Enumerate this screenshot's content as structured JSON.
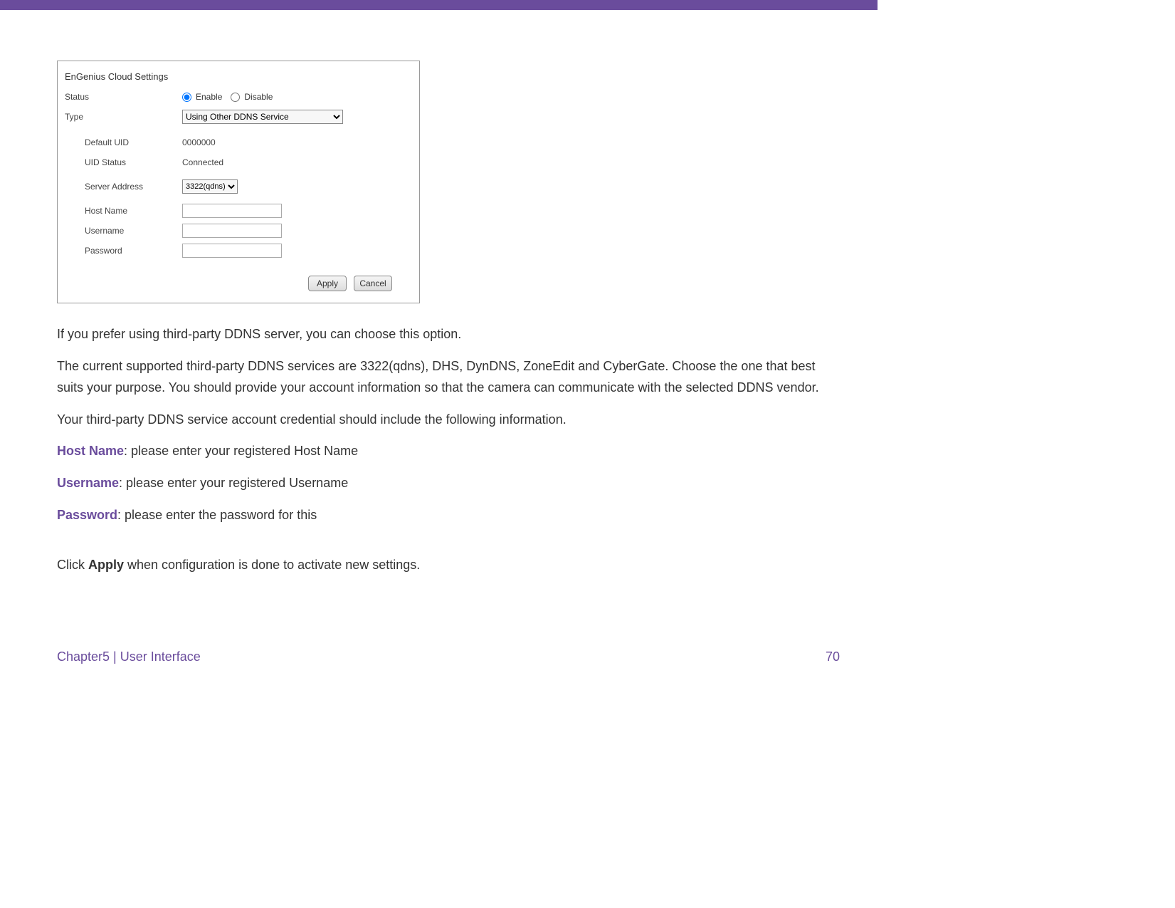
{
  "panel": {
    "title": "EnGenius Cloud Settings",
    "status_label": "Status",
    "enable_label": "Enable",
    "disable_label": "Disable",
    "type_label": "Type",
    "type_value": "Using Other DDNS Service",
    "default_uid_label": "Default UID",
    "default_uid_value": "0000000",
    "uid_status_label": "UID Status",
    "uid_status_value": "Connected",
    "server_address_label": "Server Address",
    "server_address_value": "3322(qdns)",
    "host_name_label": "Host Name",
    "host_name_value": "",
    "username_label": "Username",
    "username_value": "",
    "password_label": "Password",
    "password_value": "",
    "apply_label": "Apply",
    "cancel_label": "Cancel"
  },
  "doc": {
    "p1": "If you prefer using third-party DDNS server, you can choose this option.",
    "p2": "The current supported third-party DDNS services are 3322(qdns), DHS, DynDNS, ZoneEdit and CyberGate. Choose the one that best suits your purpose. You should provide your account information so that the camera can communicate with the selected DDNS vendor.",
    "p3": "Your third-party DDNS service account credential should include the following information.",
    "host_name_term": "Host Name",
    "host_name_desc": ": please enter your registered Host Name",
    "username_term": "Username",
    "username_desc": ": please enter your registered Username",
    "password_term": "Password",
    "password_desc": ": please enter the password for this",
    "apply_pre": "Click ",
    "apply_bold": "Apply",
    "apply_post": " when configuration is done to activate new settings."
  },
  "footer": {
    "chapter": "Chapter5  |  User Interface",
    "page": "70"
  }
}
